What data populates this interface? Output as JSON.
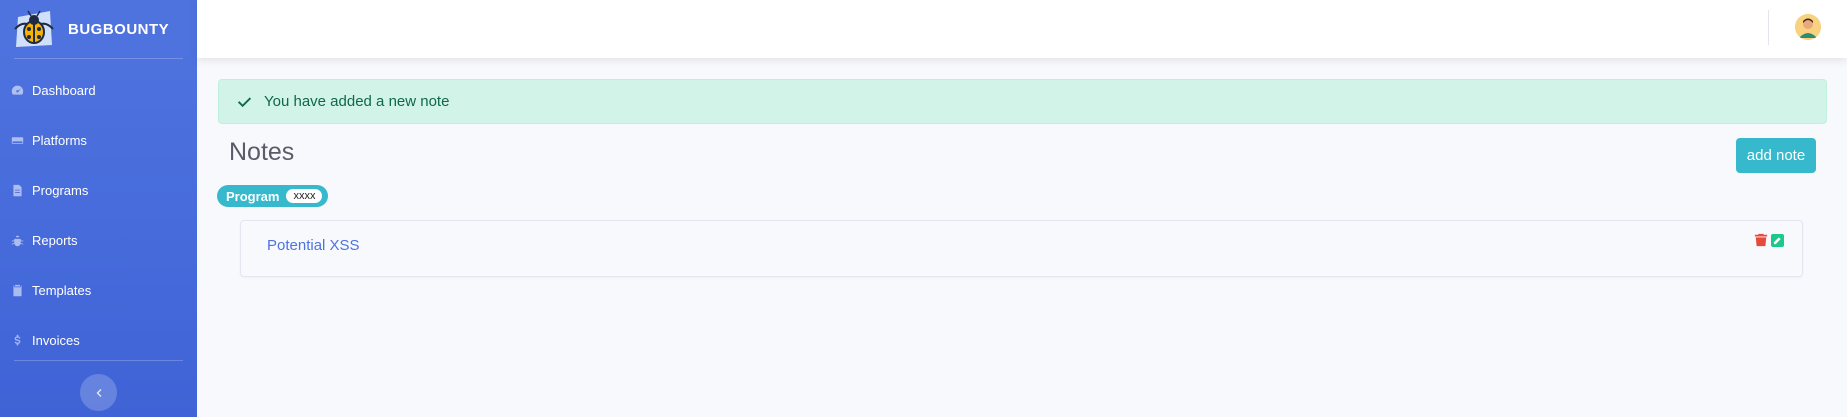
{
  "brand": {
    "name": "BUGBOUNTY",
    "logo_icon": "bug-logo"
  },
  "sidebar": {
    "items": [
      {
        "label": "Dashboard",
        "icon": "tachometer-icon"
      },
      {
        "label": "Platforms",
        "icon": "hdd-icon"
      },
      {
        "label": "Programs",
        "icon": "file-icon"
      },
      {
        "label": "Reports",
        "icon": "bug-icon"
      },
      {
        "label": "Templates",
        "icon": "clipboard-icon"
      },
      {
        "label": "Invoices",
        "icon": "dollar-icon"
      }
    ],
    "toggle_icon": "chevron-left-icon"
  },
  "topbar": {
    "avatar_icon": "user-avatar"
  },
  "alert": {
    "message": "You have added a new note",
    "icon": "check-icon"
  },
  "page": {
    "title": "Notes",
    "add_button_label": "add note"
  },
  "filter": {
    "label": "Program",
    "value": "xxxx"
  },
  "notes": [
    {
      "title": "Potential XSS"
    }
  ],
  "colors": {
    "sidebar": "#4e73df",
    "info": "#36b9cc",
    "success_bg": "#d2f4e8",
    "danger": "#e74a3b",
    "success": "#1cc88a"
  }
}
